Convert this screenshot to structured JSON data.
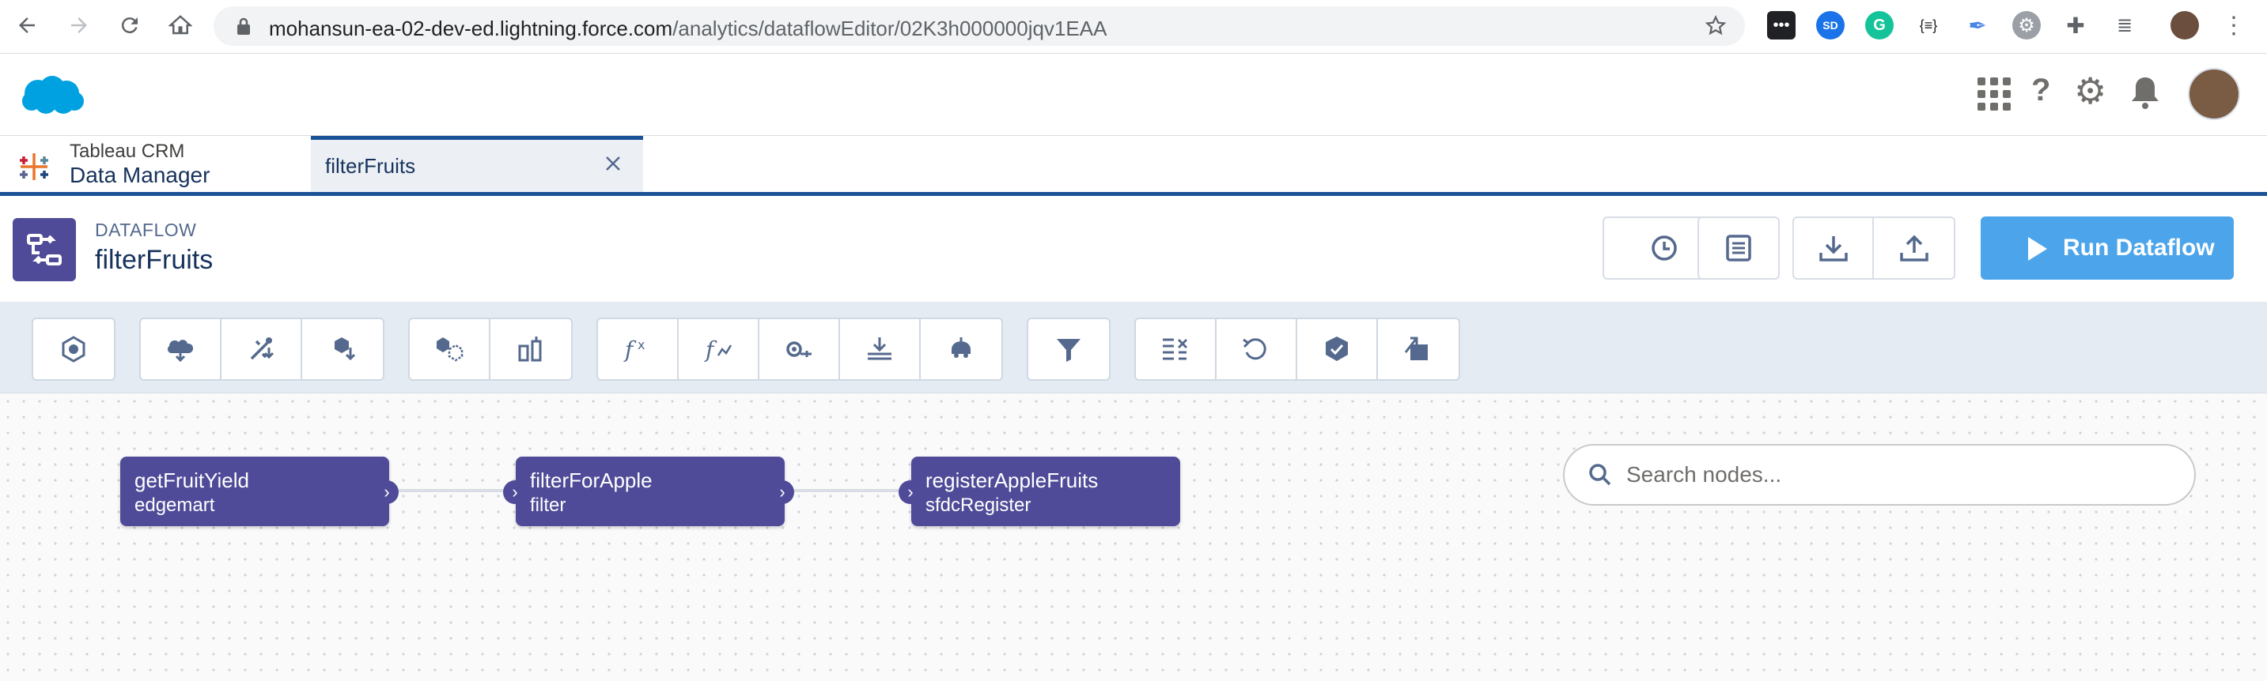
{
  "browser": {
    "url_host": "mohansun-ea-02-dev-ed.lightning.force.com",
    "url_path": "/analytics/dataflowEditor/02K3h000000jqv1EAA",
    "ext_badge": "SD"
  },
  "app": {
    "brand_line1": "Tableau CRM",
    "brand_line2": "Data Manager",
    "tab_label": "filterFruits"
  },
  "page": {
    "eyebrow": "DATAFLOW",
    "title": "filterFruits",
    "run_label": "Run Dataflow"
  },
  "toolbar": {
    "groups": [
      [
        "dataset-builder"
      ],
      [
        "sfdc-digest",
        "digest",
        "edgemart"
      ],
      [
        "append",
        "augment"
      ],
      [
        "compute-expression",
        "compute-relative",
        "dim2mea",
        "flatten",
        "prediction"
      ],
      [
        "filter"
      ],
      [
        "slice-dataset",
        "update",
        "sfdc-register",
        "export"
      ]
    ]
  },
  "nodes": [
    {
      "name": "getFruitYield",
      "type": "edgemart"
    },
    {
      "name": "filterForApple",
      "type": "filter"
    },
    {
      "name": "registerAppleFruits",
      "type": "sfdcRegister"
    }
  ],
  "search": {
    "placeholder": "Search nodes..."
  },
  "colors": {
    "brand": "#00a1e0",
    "accent": "#1b5297",
    "node": "#4f4b98",
    "run": "#4ca5ea"
  }
}
